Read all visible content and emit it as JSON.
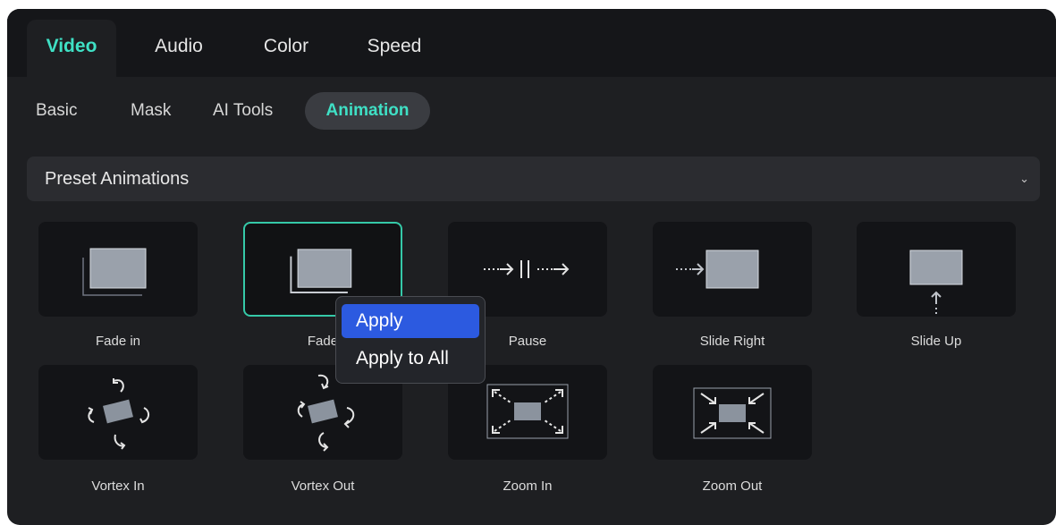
{
  "tabs": [
    {
      "label": "Video",
      "active": true
    },
    {
      "label": "Audio",
      "active": false
    },
    {
      "label": "Color",
      "active": false
    },
    {
      "label": "Speed",
      "active": false
    }
  ],
  "subtabs": [
    {
      "label": "Basic",
      "active": false
    },
    {
      "label": "Mask",
      "active": false
    },
    {
      "label": "AI Tools",
      "active": false
    },
    {
      "label": "Animation",
      "active": true
    }
  ],
  "section": {
    "title": "Preset Animations",
    "icon": "chevron-down-icon"
  },
  "presets": [
    {
      "label": "Fade in",
      "icon": "fade-in-icon"
    },
    {
      "label": "Fade",
      "icon": "fade-out-icon",
      "selected": true
    },
    {
      "label": "Pause",
      "icon": "pause-icon"
    },
    {
      "label": "Slide Right",
      "icon": "slide-right-icon"
    },
    {
      "label": "Slide Up",
      "icon": "slide-up-icon"
    },
    {
      "label": "Vortex In",
      "icon": "vortex-in-icon"
    },
    {
      "label": "Vortex Out",
      "icon": "vortex-out-icon"
    },
    {
      "label": "Zoom In",
      "icon": "zoom-in-icon"
    },
    {
      "label": "Zoom Out",
      "icon": "zoom-out-icon"
    }
  ],
  "context_menu": {
    "items": [
      {
        "label": "Apply",
        "highlighted": true
      },
      {
        "label": "Apply to All",
        "highlighted": false
      }
    ]
  },
  "colors": {
    "accent": "#3fe0c5",
    "menu_highlight": "#2c5ae0",
    "panel_bg": "#1e1f22"
  }
}
